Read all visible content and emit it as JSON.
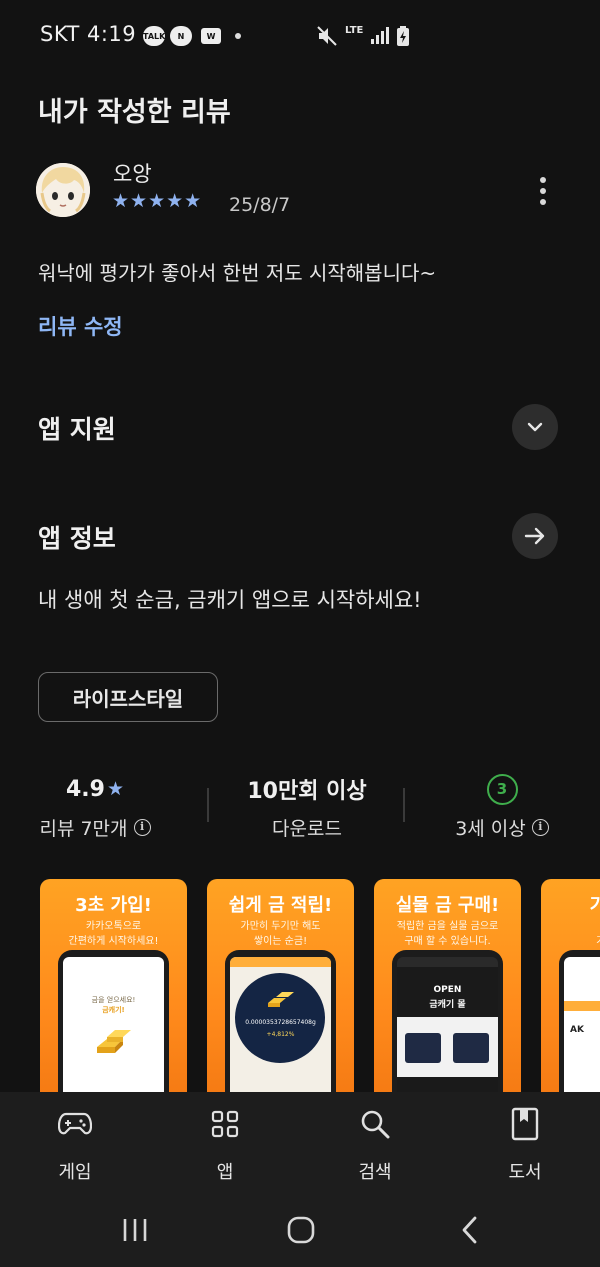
{
  "status_bar": {
    "carrier_time": "SKT 4:19",
    "badges": [
      "TALK",
      "N",
      "W"
    ],
    "network": "LTE"
  },
  "page": {
    "title": "내가 작성한 리뷰"
  },
  "review": {
    "author": "오앙",
    "rating": 5,
    "stars": "★★★★★",
    "date": "25/8/7",
    "text": "워낙에 평가가 좋아서 한번 저도 시작해봅니다~",
    "edit_label": "리뷰 수정"
  },
  "sections": {
    "support": "앱 지원",
    "info": "앱 정보"
  },
  "app": {
    "description": "내 생애 첫 순금, 금캐기 앱으로 시작하세요!",
    "category": "라이프스타일"
  },
  "stats": {
    "rating_value": "4.9",
    "rating_star": "★",
    "rating_label": "리뷰 7만개",
    "downloads_value": "10만회 이상",
    "downloads_label": "다운로드",
    "age_value": "3",
    "age_label": "3세 이상",
    "info_glyph": "i"
  },
  "screenshots": [
    {
      "headline": "3초 가입!",
      "sub": "카카오톡으로\n간편하게 시작하세요!",
      "screen": [
        "금을 얻으세요!",
        "금캐기!"
      ]
    },
    {
      "headline": "쉽게 금 적립!",
      "sub": "가만히 두기만 해도\n쌓이는 순금!",
      "screen": [
        "0.0000353728657408g",
        "+4,812%"
      ]
    },
    {
      "headline": "실물 금 구매!",
      "sub": "적립한 금을 실물 금으로\n구매 할 수 있습니다.",
      "screen": [
        "OPEN",
        "금캐기 몰"
      ]
    },
    {
      "headline": "기프티",
      "sub": "적립한\n기프티콘",
      "screen": [
        "AK"
      ]
    }
  ],
  "bottom_nav": [
    {
      "label": "게임",
      "icon": "gamepad-icon"
    },
    {
      "label": "앱",
      "icon": "apps-grid-icon"
    },
    {
      "label": "검색",
      "icon": "search-icon"
    },
    {
      "label": "도서",
      "icon": "book-icon"
    }
  ],
  "colors": {
    "background": "#121212",
    "accent_blue": "#8fb7f5",
    "age_green": "#3fae4c",
    "screenshot_orange": "#ff9a20"
  }
}
